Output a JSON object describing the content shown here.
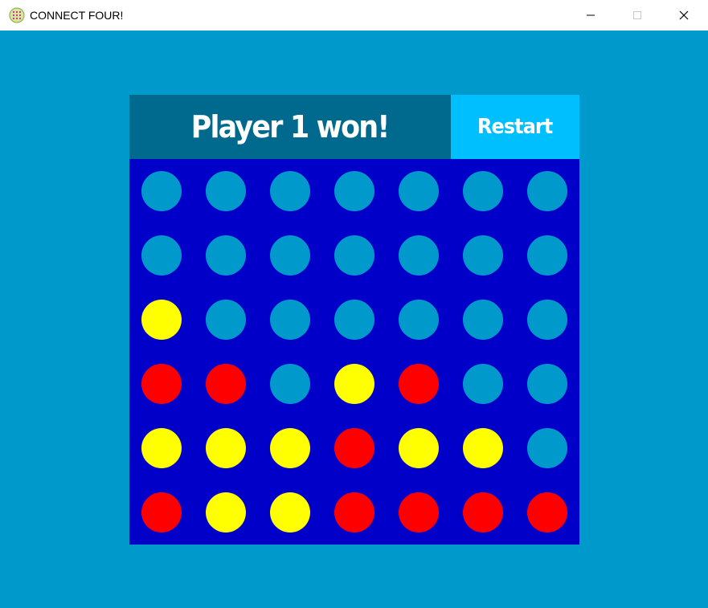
{
  "window": {
    "title": "CONNECT FOUR!"
  },
  "colors": {
    "background": "#0099cc",
    "board": "#0000c8",
    "empty": "#0099cc",
    "player1": "#ffff00",
    "player2": "#ff0000",
    "status_bg": "#006a8e",
    "restart_bg": "#00bfff"
  },
  "status": {
    "text": "Player 1 won!"
  },
  "restart": {
    "label": "Restart"
  },
  "board": {
    "rows": 6,
    "columns": 7,
    "legend": {
      "0": "empty",
      "1": "player1 (yellow)",
      "2": "player2 (red)"
    },
    "cells": [
      [
        0,
        0,
        0,
        0,
        0,
        0,
        0
      ],
      [
        0,
        0,
        0,
        0,
        0,
        0,
        0
      ],
      [
        1,
        0,
        0,
        0,
        0,
        0,
        0
      ],
      [
        2,
        2,
        0,
        1,
        2,
        0,
        0
      ],
      [
        1,
        1,
        1,
        2,
        1,
        1,
        0
      ],
      [
        2,
        1,
        1,
        2,
        2,
        2,
        2
      ]
    ]
  }
}
